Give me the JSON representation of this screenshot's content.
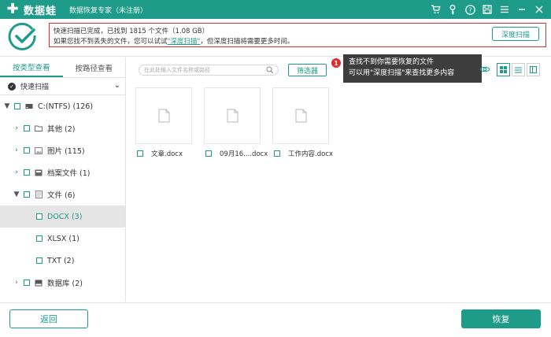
{
  "titlebar": {
    "app_name": "数据蛙",
    "app_subtitle": "数据恢复专家（未注册）",
    "icons": [
      "cart-icon",
      "key-icon",
      "help-icon",
      "save-icon",
      "menu-icon",
      "minimize-icon",
      "close-icon"
    ]
  },
  "banner": {
    "line1": "快速扫描已完成，已找到 1815 个文件（1.08 GB）",
    "line2_prefix": "如果您找不到丢失的文件，您可以试试",
    "line2_link": "\"深度扫描\"",
    "line2_suffix": "，但深度扫描将需要更多时间。",
    "deep_scan_label": "深度扫描"
  },
  "tabs": [
    {
      "label": "按类型查看",
      "active": true
    },
    {
      "label": "按路径查看",
      "active": false
    }
  ],
  "quickscan_label": "快速扫描",
  "tree": [
    {
      "label": "C:(NTFS) (126)",
      "arrow": "▼",
      "icon": "drive-icon",
      "level": 0
    },
    {
      "label": "其他 (2)",
      "arrow": "›",
      "icon": "folder-icon",
      "level": 1
    },
    {
      "label": "图片 (115)",
      "arrow": "›",
      "icon": "image-icon",
      "level": 1
    },
    {
      "label": "档案文件 (1)",
      "arrow": "›",
      "icon": "archive-icon",
      "level": 1
    },
    {
      "label": "文件 (6)",
      "arrow": "▼",
      "icon": "document-icon",
      "level": 1
    },
    {
      "label": "DOCX (3)",
      "arrow": "",
      "icon": "",
      "level": 2,
      "selected": true
    },
    {
      "label": "XLSX (1)",
      "arrow": "",
      "icon": "",
      "level": 2
    },
    {
      "label": "TXT (2)",
      "arrow": "",
      "icon": "",
      "level": 2
    },
    {
      "label": "数据库 (2)",
      "arrow": "›",
      "icon": "database-icon",
      "level": 1
    }
  ],
  "search": {
    "placeholder": "在此处输入文件名称或路径"
  },
  "filter_label": "筛选器",
  "tooltip": {
    "badge": "1",
    "line1": "查找不到你需要恢复的文件",
    "line2": "可以用\"深度扫描\"来查找更多内容"
  },
  "files": [
    {
      "name": "文章.docx"
    },
    {
      "name": "09月16....docx"
    },
    {
      "name": "工作内容.docx"
    }
  ],
  "bottom": {
    "back_label": "返回",
    "recover_label": "恢复"
  },
  "colors": {
    "accent": "#1f9b8a",
    "alert": "#e12d2d"
  }
}
